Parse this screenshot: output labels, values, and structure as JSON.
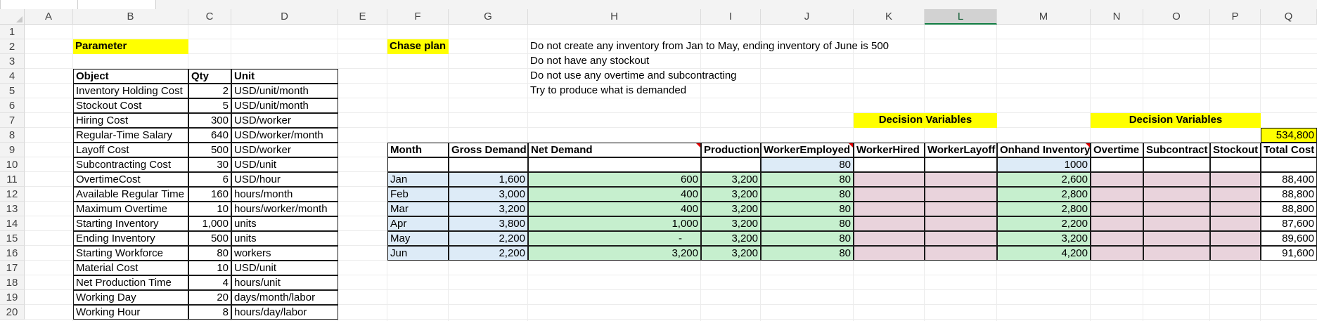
{
  "columns": [
    "A",
    "B",
    "C",
    "D",
    "E",
    "F",
    "G",
    "H",
    "I",
    "J",
    "K",
    "L",
    "M",
    "N",
    "O",
    "P",
    "Q"
  ],
  "rows": [
    "1",
    "2",
    "3",
    "4",
    "5",
    "6",
    "7",
    "8",
    "9",
    "10",
    "11",
    "12",
    "13",
    "14",
    "15",
    "16",
    "17",
    "18",
    "19",
    "20"
  ],
  "selected_column": "L",
  "parameter": {
    "title": "Parameter",
    "headers": [
      "Object",
      "Qty",
      "Unit"
    ],
    "rows": [
      [
        "Inventory Holding Cost",
        "2",
        "USD/unit/month"
      ],
      [
        "Stockout Cost",
        "5",
        "USD/unit/month"
      ],
      [
        "Hiring Cost",
        "300",
        "USD/worker"
      ],
      [
        "Regular-Time Salary",
        "640",
        "USD/worker/month"
      ],
      [
        "Layoff Cost",
        "500",
        "USD/worker"
      ],
      [
        "Subcontracting Cost",
        "30",
        "USD/unit"
      ],
      [
        "OvertimeCost",
        "6",
        "USD/hour"
      ],
      [
        "Available Regular Time",
        "160",
        "hours/month"
      ],
      [
        "Maximum Overtime",
        "10",
        "hours/worker/month"
      ],
      [
        "Starting Inventory",
        "1,000",
        "units"
      ],
      [
        "Ending Inventory",
        "500",
        "units"
      ],
      [
        "Starting Workforce",
        "80",
        "workers"
      ],
      [
        "Material Cost",
        "10",
        "USD/unit"
      ],
      [
        "Net Production Time",
        "4",
        "hours/unit"
      ],
      [
        "Working Day",
        "20",
        "days/month/labor"
      ],
      [
        "Working Hour",
        "8",
        "hours/day/labor"
      ]
    ]
  },
  "plan": {
    "title": "Chase plan",
    "notes": [
      "Do not create any inventory from Jan to May, ending inventory of June is 500",
      "Do not have any stockout",
      "Do not use any overtime and subcontracting",
      "Try to produce what is demanded"
    ],
    "decision_label_1": "Decision Variables",
    "decision_label_2": "Decision Variables",
    "grand_total": "534,800",
    "headers": [
      "Month",
      "Gross Demand",
      "Net Demand",
      "Production",
      "WorkerEmployed",
      "WorkerHired",
      "WorkerLayoff",
      "Onhand Inventory",
      "Overtime",
      "Subcontract",
      "Stockout",
      "Total Cost"
    ],
    "initial_workers": "80",
    "initial_inventory": "1000",
    "months": [
      {
        "month": "Jan",
        "gross": "1,600",
        "net": "600",
        "production": "3,200",
        "workers": "80",
        "inventory": "2,600",
        "total": "88,400"
      },
      {
        "month": "Feb",
        "gross": "3,000",
        "net": "400",
        "production": "3,200",
        "workers": "80",
        "inventory": "2,800",
        "total": "88,800"
      },
      {
        "month": "Mar",
        "gross": "3,200",
        "net": "400",
        "production": "3,200",
        "workers": "80",
        "inventory": "2,800",
        "total": "88,800"
      },
      {
        "month": "Apr",
        "gross": "3,800",
        "net": "1,000",
        "production": "3,200",
        "workers": "80",
        "inventory": "2,200",
        "total": "87,600"
      },
      {
        "month": "May",
        "gross": "2,200",
        "net": "-",
        "production": "3,200",
        "workers": "80",
        "inventory": "3,200",
        "total": "89,600"
      },
      {
        "month": "Jun",
        "gross": "2,200",
        "net": "3,200",
        "production": "3,200",
        "workers": "80",
        "inventory": "4,200",
        "total": "91,600"
      }
    ]
  }
}
